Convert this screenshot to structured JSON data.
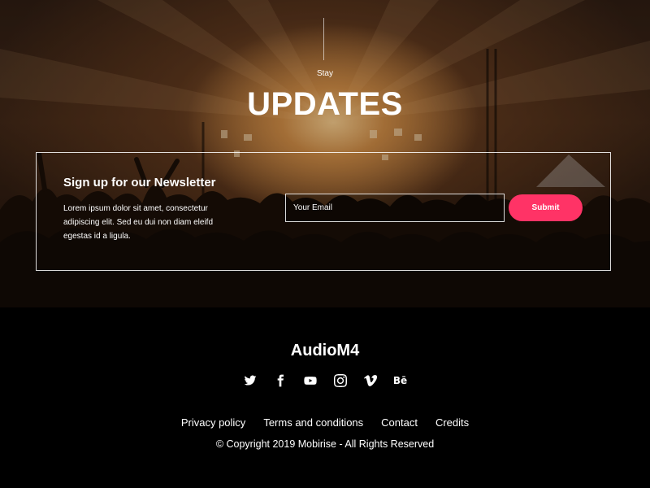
{
  "hero": {
    "eyebrow": "Stay",
    "title": "UPDATES"
  },
  "newsletter": {
    "heading": "Sign up for our Newsletter",
    "body": "Lorem ipsum dolor sit amet, consectetur adipiscing elit. Sed eu dui non diam eleifd egestas id a ligula.",
    "email_placeholder": "Your Email",
    "email_value": "",
    "submit_label": "Submit"
  },
  "footer": {
    "brand": "AudioM4",
    "social_icons": [
      "twitter-icon",
      "facebook-icon",
      "youtube-icon",
      "instagram-icon",
      "vimeo-icon",
      "behance-icon"
    ],
    "behance_glyph": "Bē",
    "links": [
      "Privacy policy",
      "Terms and conditions",
      "Contact",
      "Credits"
    ],
    "copyright": "© Copyright 2019 Mobirise - All Rights Reserved"
  },
  "colors": {
    "accent": "#ff3366",
    "footer_bg": "#000000",
    "hero_tint": "#3b2416"
  }
}
